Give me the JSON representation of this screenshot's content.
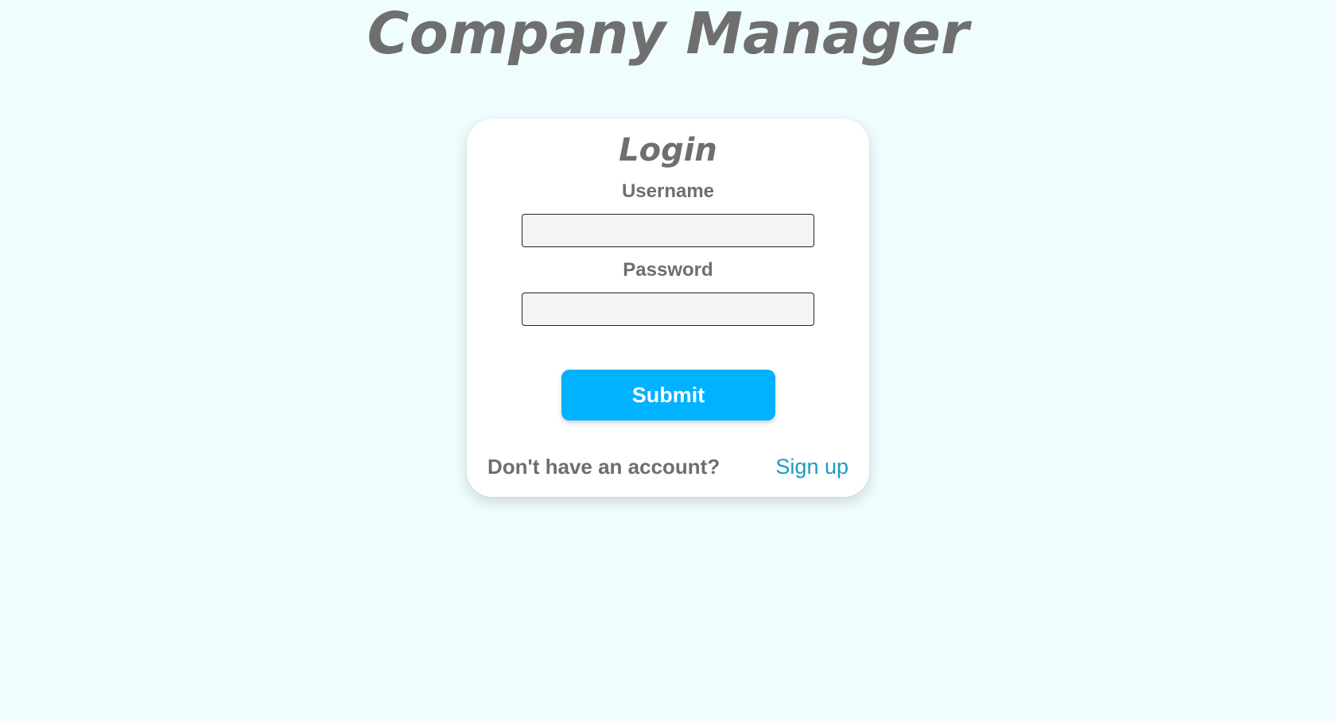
{
  "app": {
    "title": "Company Manager"
  },
  "login_form": {
    "title": "Login",
    "username_label": "Username",
    "username_value": "",
    "password_label": "Password",
    "password_value": "",
    "submit_label": "Submit",
    "no_account_text": "Don't have an account?",
    "signup_label": "Sign up"
  },
  "colors": {
    "background": "#f0fdff",
    "card": "#ffffff",
    "primary_button": "#00b2ff",
    "link": "#1f9ac1",
    "text": "#6e6e6e"
  }
}
